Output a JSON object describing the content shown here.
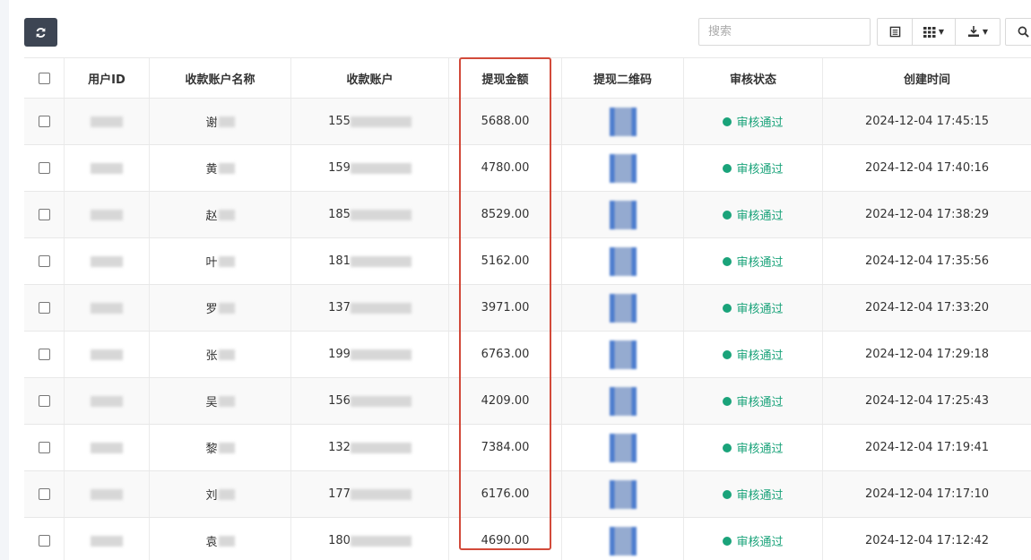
{
  "toolbar": {
    "refresh_icon": "refresh-icon",
    "search_placeholder": "搜索",
    "buttons": [
      {
        "name": "list-view-icon"
      },
      {
        "name": "columns-icon"
      },
      {
        "name": "export-icon"
      },
      {
        "name": "search-icon"
      }
    ]
  },
  "table": {
    "headers": [
      "用户ID",
      "收款账户名称",
      "收款账户",
      "提现金额",
      "提现二维码",
      "审核状态",
      "创建时间"
    ],
    "rows": [
      {
        "name": "谢",
        "account": "155",
        "amount": "5688.00",
        "status": "审核通过",
        "created": "2024-12-04 17:45:15"
      },
      {
        "name": "黄",
        "account": "159",
        "amount": "4780.00",
        "status": "审核通过",
        "created": "2024-12-04 17:40:16"
      },
      {
        "name": "赵",
        "account": "185",
        "amount": "8529.00",
        "status": "审核通过",
        "created": "2024-12-04 17:38:29"
      },
      {
        "name": "叶",
        "account": "181",
        "amount": "5162.00",
        "status": "审核通过",
        "created": "2024-12-04 17:35:56"
      },
      {
        "name": "罗",
        "account": "137",
        "amount": "3971.00",
        "status": "审核通过",
        "created": "2024-12-04 17:33:20"
      },
      {
        "name": "张",
        "account": "199",
        "amount": "6763.00",
        "status": "审核通过",
        "created": "2024-12-04 17:29:18"
      },
      {
        "name": "吴",
        "account": "156",
        "amount": "4209.00",
        "status": "审核通过",
        "created": "2024-12-04 17:25:43"
      },
      {
        "name": "黎",
        "account": "132",
        "amount": "7384.00",
        "status": "审核通过",
        "created": "2024-12-04 17:19:41"
      },
      {
        "name": "刘",
        "account": "177",
        "amount": "6176.00",
        "status": "审核通过",
        "created": "2024-12-04 17:17:10"
      },
      {
        "name": "袁",
        "account": "180",
        "amount": "4690.00",
        "status": "审核通过",
        "created": "2024-12-04 17:12:42"
      }
    ]
  },
  "colors": {
    "highlight_border": "#d24a3a",
    "status_green": "#1aa37a",
    "refresh_button": "#3d4553"
  }
}
